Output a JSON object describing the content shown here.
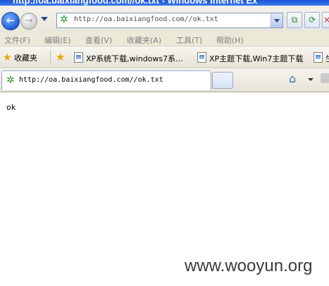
{
  "window": {
    "title": "http://oa.baixiangfood.com//ok.txt - Windows Internet Ex"
  },
  "address_bar": {
    "url": "http://oa.baixiangfood.com//ok.txt",
    "site_icon": "green-gear-icon"
  },
  "menu": {
    "items": [
      "文件(F)",
      "编辑(E)",
      "查看(V)",
      "收藏夹(A)",
      "工具(T)",
      "帮助(H)"
    ]
  },
  "favorites": {
    "label": "收藏夹",
    "items": [
      "XP系统下载,windows7系...",
      "XP主题下载,Win7主题下载",
      "生"
    ]
  },
  "tab": {
    "title": "http://oa.baixiangfood.com//ok.txt"
  },
  "page": {
    "text": "ok"
  },
  "watermark": {
    "text": "www.wooyun.org"
  },
  "colors": {
    "titlebar": "#1b53d6",
    "menu_disabled_text": "#808080"
  }
}
